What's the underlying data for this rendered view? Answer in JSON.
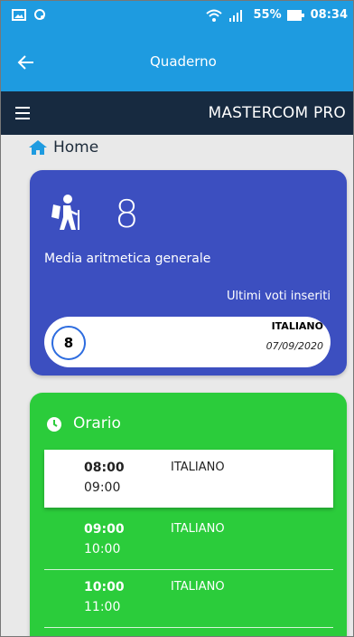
{
  "status_bar": {
    "battery": "55%",
    "time": "08:34"
  },
  "app_bar": {
    "title": "Quaderno"
  },
  "nav_bar": {
    "brand": "MASTERCOM PRO"
  },
  "breadcrumb": {
    "label": "Home"
  },
  "media_card": {
    "average": "8",
    "label": "Media aritmetica generale",
    "last_votes_label": "Ultimi voti inseriti",
    "last_vote": {
      "grade": "8",
      "subject": "ITALIANO",
      "date": "07/09/2020"
    },
    "color": "#3c4fc0"
  },
  "schedule_card": {
    "title": "Orario",
    "color": "#2bcc3b",
    "slots": [
      {
        "start": "08:00",
        "end": "09:00",
        "subject": "ITALIANO",
        "active": true
      },
      {
        "start": "09:00",
        "end": "10:00",
        "subject": "ITALIANO",
        "active": false
      },
      {
        "start": "10:00",
        "end": "11:00",
        "subject": "ITALIANO",
        "active": false
      }
    ]
  },
  "colors": {
    "app_bar": "#1e9be0",
    "nav_bar": "#172a40",
    "background": "#e9e9e9"
  }
}
